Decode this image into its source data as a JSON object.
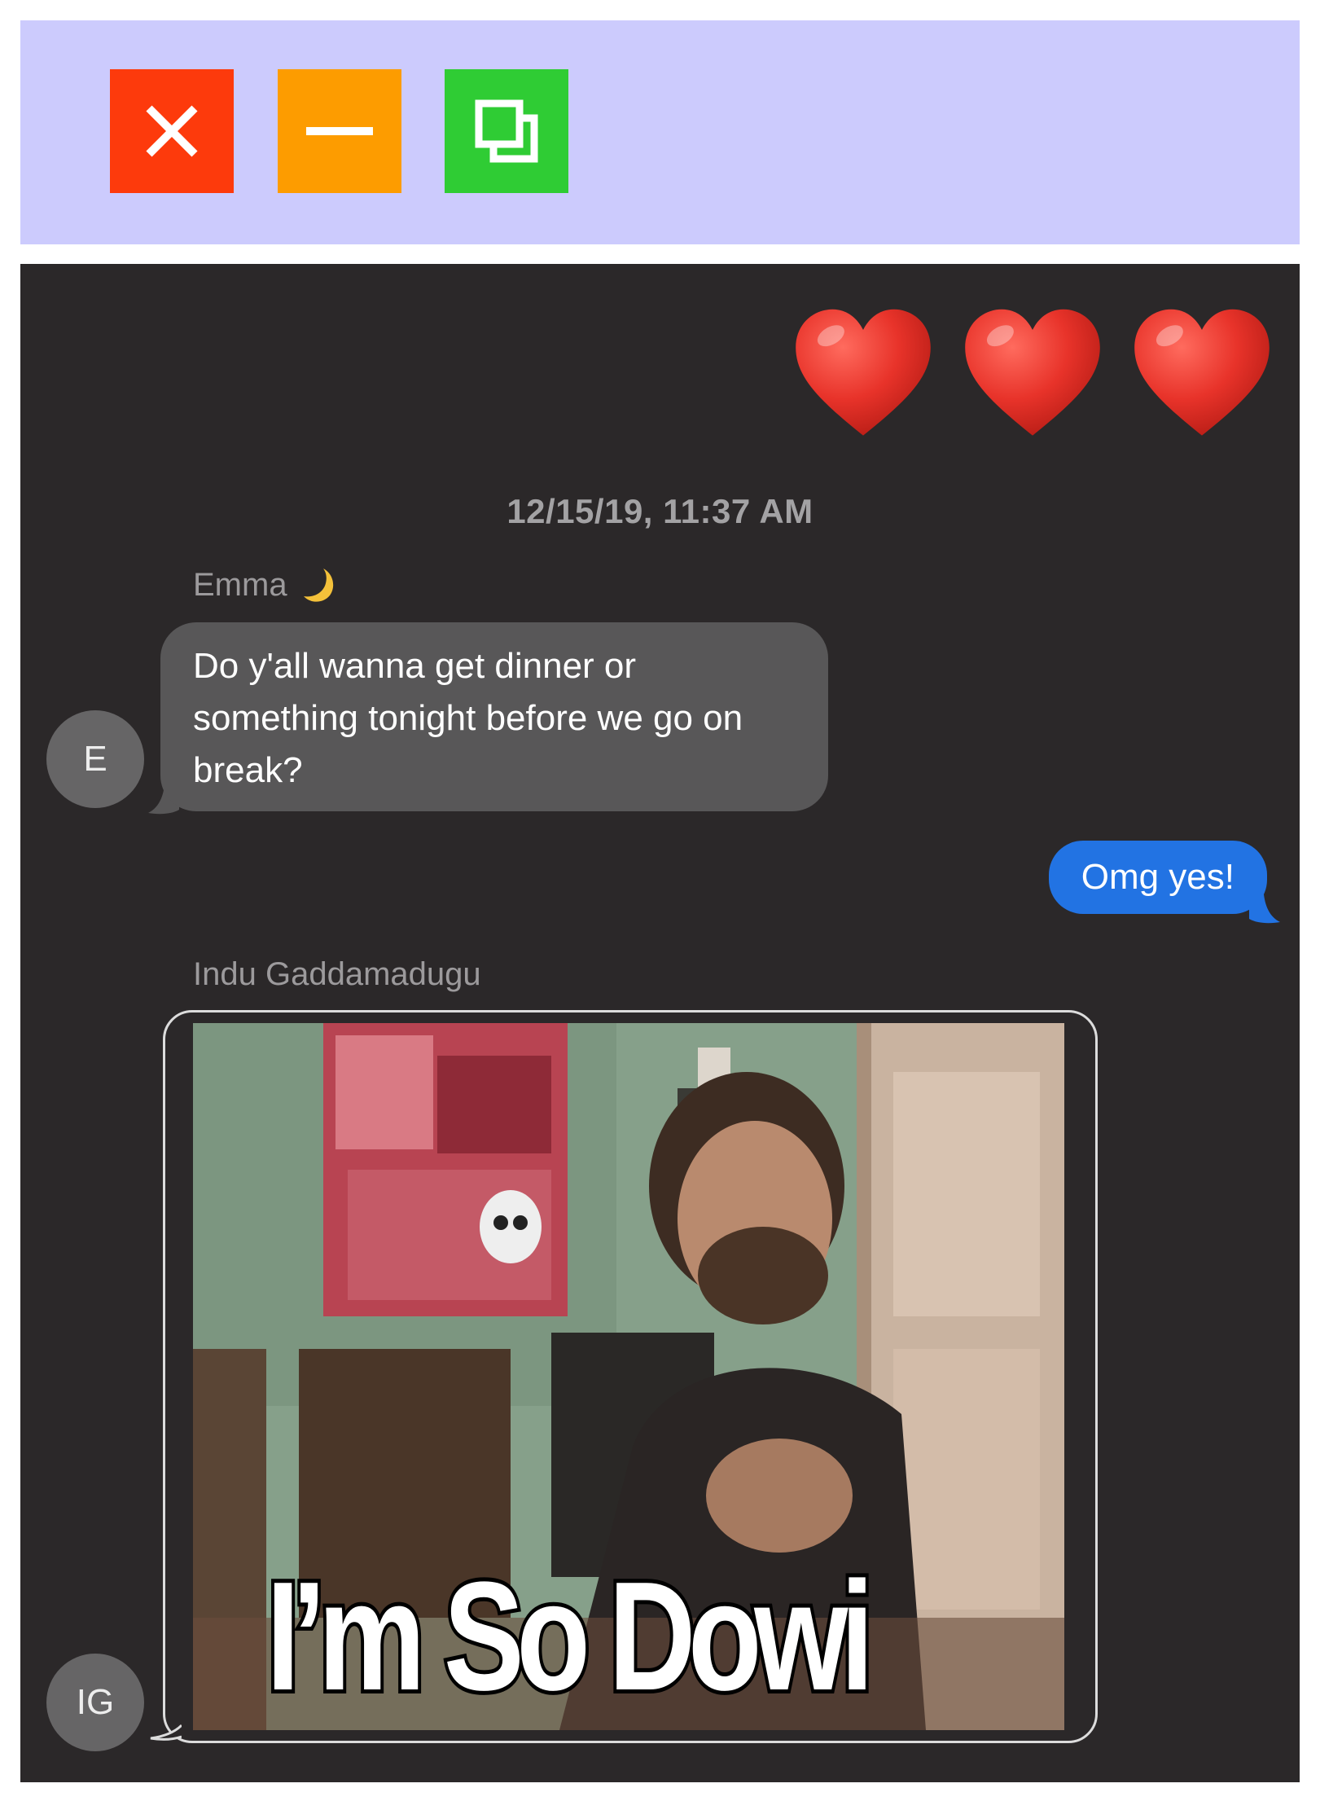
{
  "window": {
    "controls": {
      "close_icon": "close-x-icon",
      "minimize_icon": "minimize-dash-icon",
      "maximize_icon": "restore-windows-icon"
    },
    "colors": {
      "titlebar": "#cccbfd",
      "close": "#fd3a0c",
      "minimize": "#fd9c00",
      "maximize": "#2fcc34"
    }
  },
  "conversation": {
    "reaction_emoji": [
      "heart",
      "heart",
      "heart"
    ],
    "timestamp": "12/15/19, 11:37 AM",
    "messages": [
      {
        "sender": "Emma",
        "sender_emoji": "crescent-moon",
        "avatar_initials": "E",
        "text": "Do y'all wanna get dinner or something tonight before we go on break?"
      },
      {
        "sender": "me",
        "text": "Omg yes!"
      },
      {
        "sender": "Indu Gaddamadugu",
        "avatar_initials": "IG",
        "attachment": {
          "type": "gif",
          "caption": "I’m So Dowi"
        }
      }
    ],
    "colors": {
      "background": "#2b2829",
      "incoming_bubble": "#585758",
      "outgoing_bubble": "#2273e3"
    }
  }
}
